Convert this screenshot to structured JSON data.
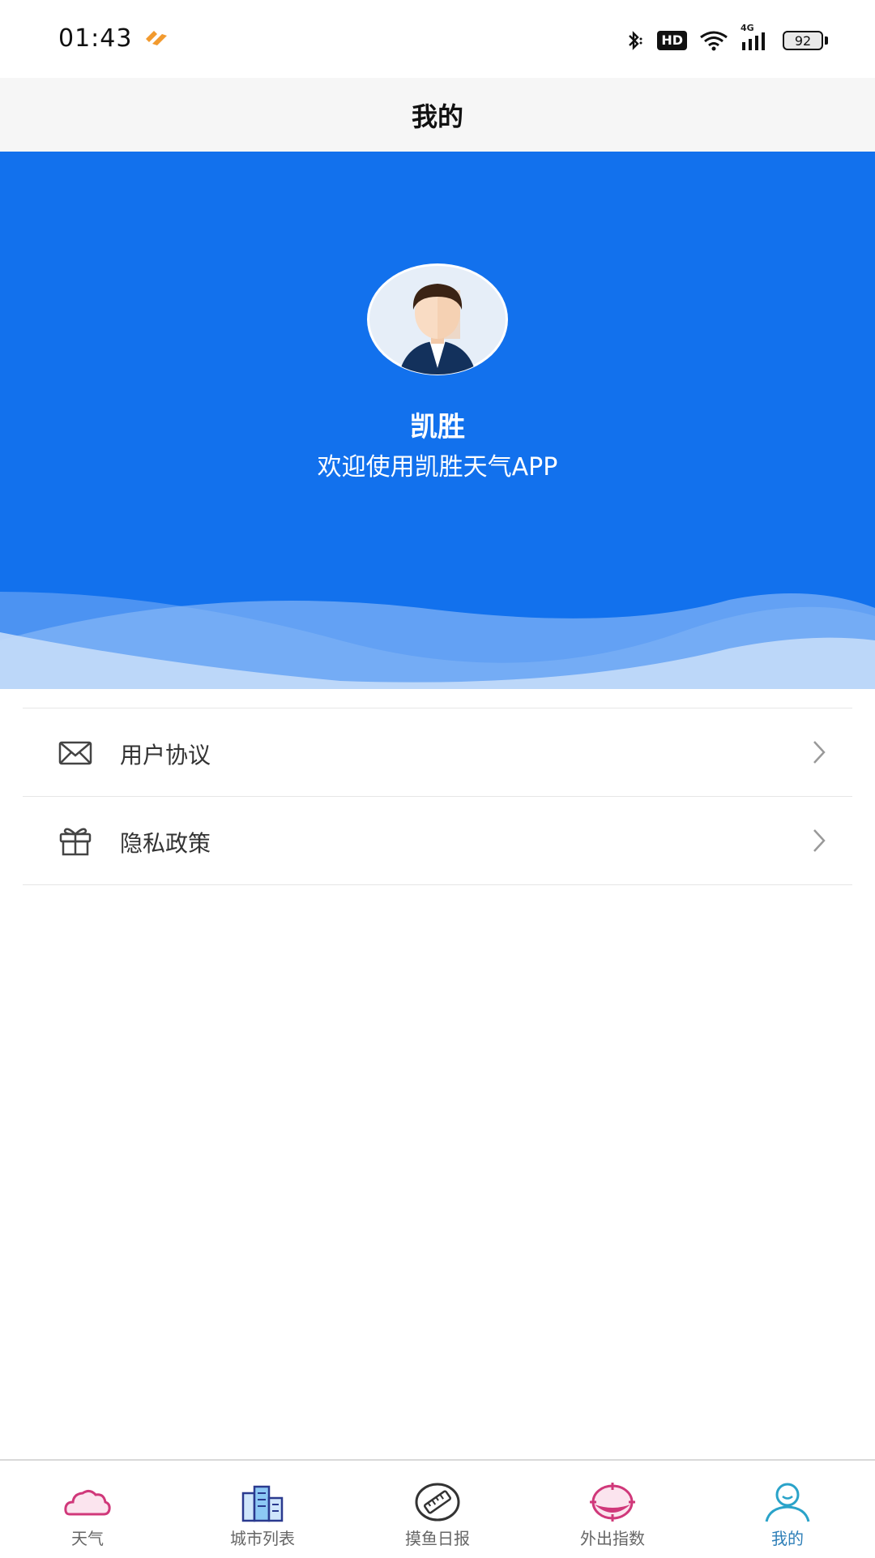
{
  "status_bar": {
    "time": "01:43",
    "hd_label": "HD",
    "network_label": "4G",
    "battery_level": "92",
    "icons": [
      "bluetooth-icon",
      "hd-icon",
      "wifi-icon",
      "signal-icon",
      "battery-icon"
    ]
  },
  "header": {
    "title": "我的"
  },
  "profile": {
    "name": "凯胜",
    "welcome": "欢迎使用凯胜天气APP",
    "colors": {
      "background": "#1271ed",
      "wave_light": "#c4dcfa"
    }
  },
  "menu": {
    "items": [
      {
        "label": "用户协议",
        "icon": "envelope-icon"
      },
      {
        "label": "隐私政策",
        "icon": "gift-icon"
      }
    ]
  },
  "tabs": {
    "items": [
      {
        "label": "天气",
        "icon": "cloud-icon"
      },
      {
        "label": "城市列表",
        "icon": "city-buildings-icon"
      },
      {
        "label": "摸鱼日报",
        "icon": "ruler-badge-icon"
      },
      {
        "label": "外出指数",
        "icon": "target-icon"
      },
      {
        "label": "我的",
        "icon": "user-icon"
      }
    ],
    "active_index": 4,
    "active_color": "#2e7fb8"
  }
}
